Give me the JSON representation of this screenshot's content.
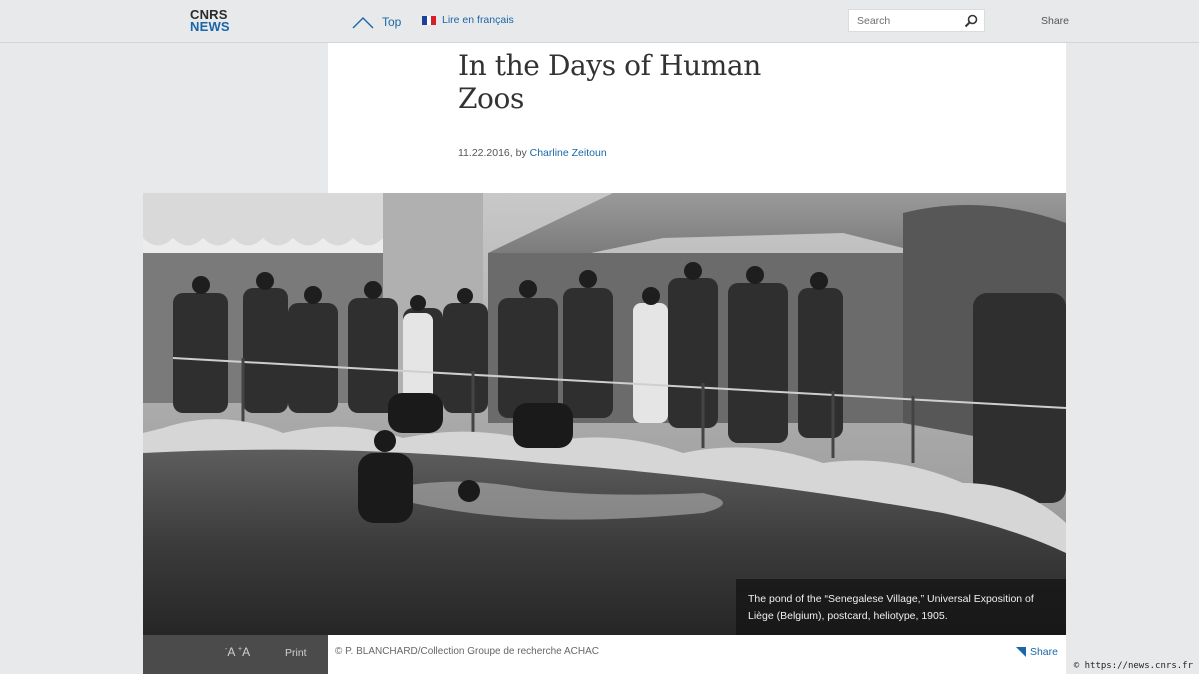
{
  "header": {
    "logo_line1": "CNRS",
    "logo_line2": "NEWS",
    "top_label": "Top",
    "lang_label": "Lire en français",
    "search_placeholder": "Search",
    "share_label": "Share"
  },
  "article": {
    "title": "In the Days of Human Zoos",
    "date": "11.22.2016",
    "by": ", by ",
    "author": "Charline Zeitoun"
  },
  "photo": {
    "caption": "The pond of the “Senegalese Village,” Universal Exposition of Liège (Belgium), postcard, heliotype, 1905.",
    "credit": "© P. BLANCHARD/Collection Groupe de recherche ACHAC"
  },
  "tools": {
    "font_size_small": "A",
    "font_size_large": "A",
    "print_label": "Print",
    "share_label": "Share"
  },
  "footer": {
    "url": "© https://news.cnrs.fr"
  },
  "colors": {
    "accent": "#1b66a8",
    "background": "#e8e9ea",
    "tools_bar": "#4b4b4b"
  }
}
